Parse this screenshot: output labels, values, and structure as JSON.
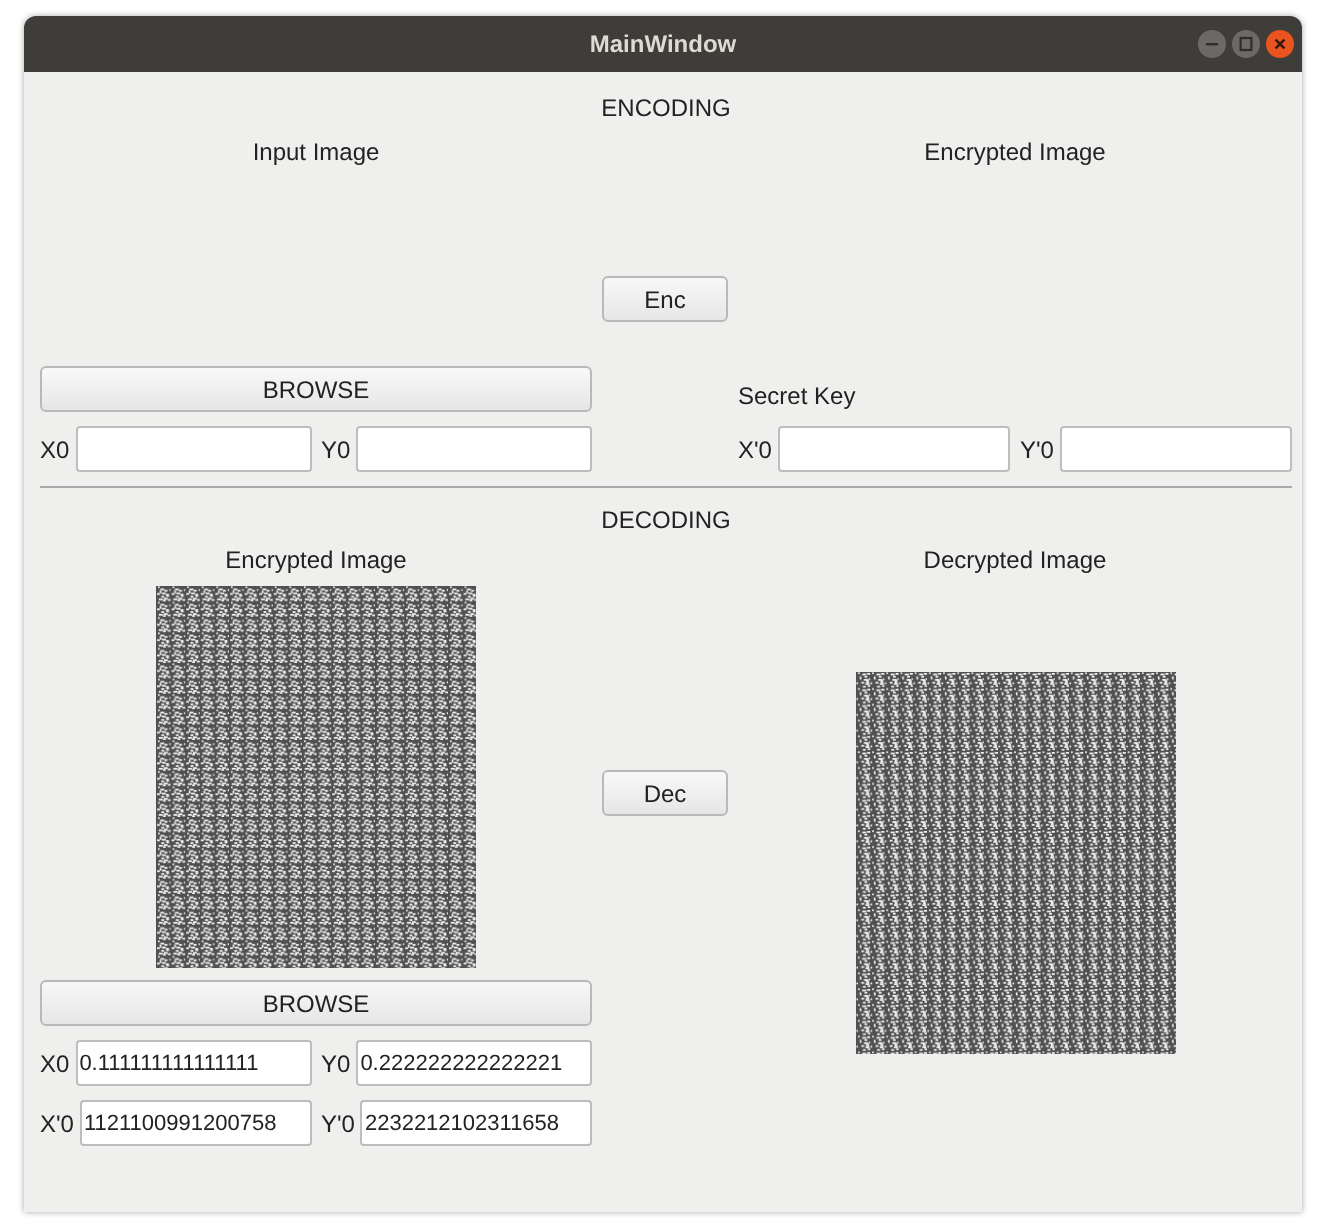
{
  "window": {
    "title": "MainWindow"
  },
  "encoding": {
    "heading": "ENCODING",
    "left_label": "Input Image",
    "right_label": "Encrypted Image",
    "action_button": "Enc",
    "browse_button": "BROWSE",
    "secret_key_label": "Secret Key",
    "left_fields": [
      {
        "label": "X0"
      },
      {
        "label": "Y0"
      }
    ],
    "right_fields": [
      {
        "label": "X'0"
      },
      {
        "label": "Y'0"
      }
    ]
  },
  "decoding": {
    "heading": "DECODING",
    "left_label": "Encrypted Image",
    "right_label": "Decrypted Image",
    "action_button": "Dec",
    "browse_button": "BROWSE",
    "field_rows": [
      [
        {
          "label": "X0",
          "value": "0.111111111111111"
        },
        {
          "label": "Y0",
          "value": "0.222222222222221"
        }
      ],
      [
        {
          "label": "X'0",
          "value": "1121100991200758"
        },
        {
          "label": "Y'0",
          "value": "2232212102311658"
        }
      ]
    ]
  }
}
